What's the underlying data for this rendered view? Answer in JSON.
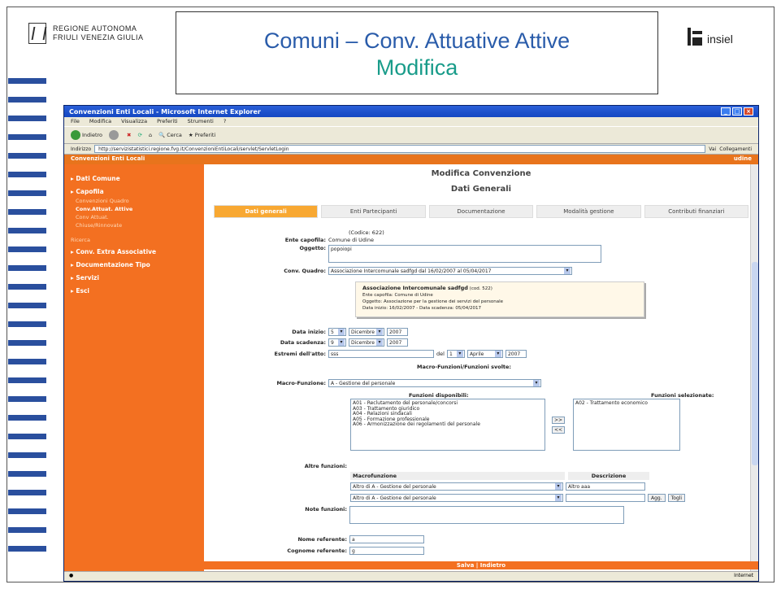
{
  "slide": {
    "title_line1": "Comuni – Conv. Attuative Attive",
    "title_line2": "Modifica",
    "left_logo": "REGIONE AUTONOMA\nFRIULI VENEZIA GIULIA",
    "right_logo": "insiel"
  },
  "browser": {
    "title": "Convenzioni Enti Locali - Microsoft Internet Explorer",
    "menu": [
      "File",
      "Modifica",
      "Visualizza",
      "Preferiti",
      "Strumenti",
      "?"
    ],
    "toolbar": [
      "Indietro",
      "Cerca",
      "Preferiti"
    ],
    "address_label": "Indirizzo",
    "address": "http://servizistatistici.regione.fvg.it/ConvenzioniEntiLocali/servlet/ServletLogin",
    "go": "Vai",
    "links": "Collegamenti",
    "status": "Internet"
  },
  "app": {
    "name": "Convenzioni Enti Locali",
    "user": "udine"
  },
  "sidebar": {
    "items": [
      "Dati Comune",
      "Capofila",
      "Conv. Extra Associative",
      "Documentazione Tipo",
      "Servizi",
      "Esci"
    ],
    "capofila_subs": [
      "Convenzioni Quadro",
      "Conv.Attuat. Attive",
      "Conv Attuat.",
      "Chiuse/Rinnovate"
    ],
    "ricerca": "Ricerca"
  },
  "main": {
    "heading": "Modifica Convenzione",
    "subheading": "Dati Generali",
    "tabs": [
      "Dati generali",
      "Enti Partecipanti",
      "Documentazione",
      "Modalità gestione",
      "Contributi finanziari"
    ],
    "codice": "(Codice: 622)",
    "ente_label": "Ente capofila:",
    "ente_value": "Comune di Udine",
    "oggetto_label": "Oggetto:",
    "oggetto_value": "popoiopi",
    "conv_label": "Conv. Quadro:",
    "conv_value": "Associazione Intercomunale sadfgd dal 16/02/2007 al 05/04/2017",
    "info_title": "Associazione Intercomunale sadfgd",
    "info_code": "(cod. 522)",
    "info_l1": "Ente capofila: Comune di Udine",
    "info_l2": "Oggetto: Associazione per la gestione dei servizi del personale",
    "info_l3": "Data inizio: 16/02/2007 - Data scadenza: 05/04/2017",
    "data_inizio_label": "Data inizio:",
    "di_day": "5",
    "di_month": "Dicembre",
    "di_year": "2007",
    "data_scad_label": "Data scadenza:",
    "ds_day": "9",
    "ds_month": "Dicembre",
    "ds_year": "2007",
    "estremi_label": "Estremi dell'atto:",
    "estremi_value": "sss",
    "del_label": "del",
    "ea_day": "1",
    "ea_month": "Aprile",
    "ea_year": "2007",
    "macro_heading": "Macro-Funzioni/Funzioni svolte:",
    "macro_label": "Macro-Funzione:",
    "macro_value": "A - Gestione del personale",
    "disp_head": "Funzioni disponibili:",
    "sel_head": "Funzioni selezionate:",
    "disp_items": [
      "A01 - Reclutamento del personale/concorsi",
      "A03 - Trattamento giuridico",
      "A04 - Relazioni sindacali",
      "A05 - Formazione professionale",
      "A06 - Armonizzazione dei regolamenti del personale"
    ],
    "sel_items": [
      "A02 - Trattamento economico"
    ],
    "btn_add": ">>",
    "btn_remove": "<<",
    "altre_label": "Altre funzioni:",
    "col_macro": "Macrofunzione",
    "col_descr": "Descrizione",
    "altre_rows": [
      {
        "macro": "Altro di A - Gestione del personale",
        "descr": "Altro aaa"
      },
      {
        "macro": "Altro di A - Gestione del personale",
        "descr": ""
      }
    ],
    "btn_agg": "Agg.",
    "btn_togli": "Togli",
    "note_label": "Note funzioni:",
    "nome_label": "Nome referente:",
    "nome_value": "a",
    "cognome_label": "Cognome referente:",
    "cognome_value": "g",
    "footer": "Salva   |   Indietro"
  }
}
